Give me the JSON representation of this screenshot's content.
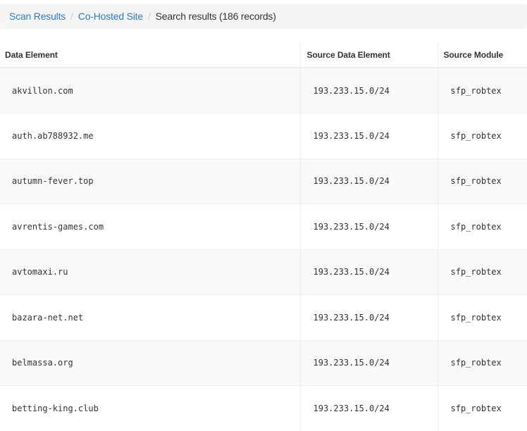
{
  "breadcrumb": {
    "items": [
      "Scan Results",
      "Co-Hosted Site"
    ],
    "separator": "/",
    "current": "Search results (186 records)"
  },
  "table": {
    "headers": [
      "Data Element",
      "Source Data Element",
      "Source Module"
    ],
    "rows": [
      {
        "data_element": "akvillon.com",
        "source_data_element": "193.233.15.0/24",
        "source_module": "sfp_robtex"
      },
      {
        "data_element": "auth.ab788932.me",
        "source_data_element": "193.233.15.0/24",
        "source_module": "sfp_robtex"
      },
      {
        "data_element": "autumn-fever.top",
        "source_data_element": "193.233.15.0/24",
        "source_module": "sfp_robtex"
      },
      {
        "data_element": "avrentis-games.com",
        "source_data_element": "193.233.15.0/24",
        "source_module": "sfp_robtex"
      },
      {
        "data_element": "avtomaxi.ru",
        "source_data_element": "193.233.15.0/24",
        "source_module": "sfp_robtex"
      },
      {
        "data_element": "bazara-net.net",
        "source_data_element": "193.233.15.0/24",
        "source_module": "sfp_robtex"
      },
      {
        "data_element": "belmassa.org",
        "source_data_element": "193.233.15.0/24",
        "source_module": "sfp_robtex"
      },
      {
        "data_element": "betting-king.club",
        "source_data_element": "193.233.15.0/24",
        "source_module": "sfp_robtex"
      }
    ]
  },
  "colors": {
    "link": "#337ab7",
    "breadcrumb_bg": "#f5f5f5",
    "row_stripe": "#f9f9f9",
    "border": "#eeeeee"
  }
}
